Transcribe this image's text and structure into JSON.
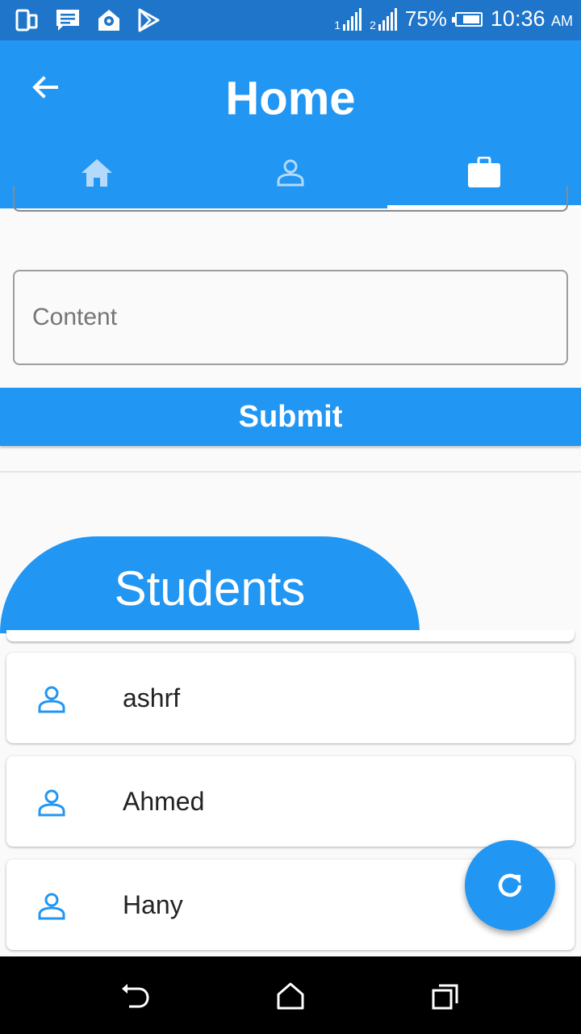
{
  "status_bar": {
    "icons": [
      "phone-screens-icon",
      "message-icon",
      "location-pin-icon",
      "play-store-icon"
    ],
    "sim1": "1",
    "sim2": "2",
    "battery": "75%",
    "battery_level": 0.75,
    "time": "10:36",
    "ampm": "AM"
  },
  "app_bar": {
    "title": "Home",
    "tabs": [
      {
        "icon": "home-icon",
        "active": false
      },
      {
        "icon": "person-icon",
        "active": false
      },
      {
        "icon": "briefcase-icon",
        "active": true
      }
    ]
  },
  "form": {
    "content_placeholder": "Content",
    "content_value": "",
    "submit_label": "Submit"
  },
  "students": {
    "title": "Students",
    "items": [
      {
        "name": "ashrf",
        "icon": "person-icon"
      },
      {
        "name": "Ahmed",
        "icon": "person-icon"
      },
      {
        "name": "Hany",
        "icon": "person-icon"
      }
    ]
  },
  "fab": {
    "icon": "refresh-icon"
  },
  "nav_bar": {
    "icons": [
      "back-icon",
      "home-icon",
      "recents-icon"
    ]
  },
  "colors": {
    "primary": "#2196f3",
    "status_bar": "#1e75c9",
    "background": "#fafafa"
  }
}
